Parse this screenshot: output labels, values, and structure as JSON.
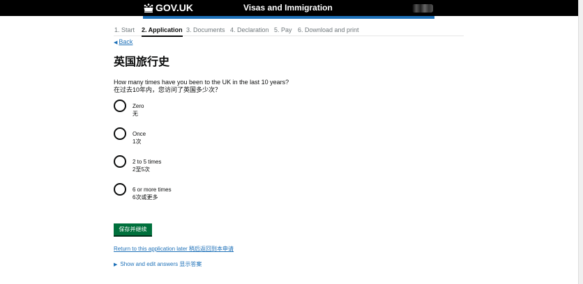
{
  "header": {
    "brand": "GOV.UK",
    "service": "Visas and Immigration",
    "crown_icon": "crown-icon"
  },
  "steps": [
    {
      "label": "1. Start",
      "state": "done"
    },
    {
      "label": "2. Application",
      "state": "active"
    },
    {
      "label": "3. Documents",
      "state": "todo"
    },
    {
      "label": "4. Declaration",
      "state": "todo"
    },
    {
      "label": "5. Pay",
      "state": "todo"
    },
    {
      "label": "6. Download and print",
      "state": "todo"
    }
  ],
  "back": {
    "label": "Back",
    "icon": "left-triangle-icon"
  },
  "page_title": "英国旅行史",
  "question": {
    "en": "How many times have you been to the UK in the last 10 years?",
    "zh": "在过去10年内，您访问了英国多少次？"
  },
  "options": [
    {
      "en": "Zero",
      "zh": "无",
      "selected": false
    },
    {
      "en": "Once",
      "zh": "1次",
      "selected": false
    },
    {
      "en": "2 to 5 times",
      "zh": "2至5次",
      "selected": false
    },
    {
      "en": "6 or more times",
      "zh": "6次或更多",
      "selected": false
    }
  ],
  "save_button": "保存并继续",
  "return_link": "Return to this application later 稍后返回到本申请",
  "details": {
    "label": "Show and edit answers 显示答案",
    "icon": "right-triangle-icon"
  },
  "colors": {
    "header_bg": "#000000",
    "accent_blue": "#1d70b8",
    "button_green": "#00703c",
    "link": "#1d70b8"
  }
}
